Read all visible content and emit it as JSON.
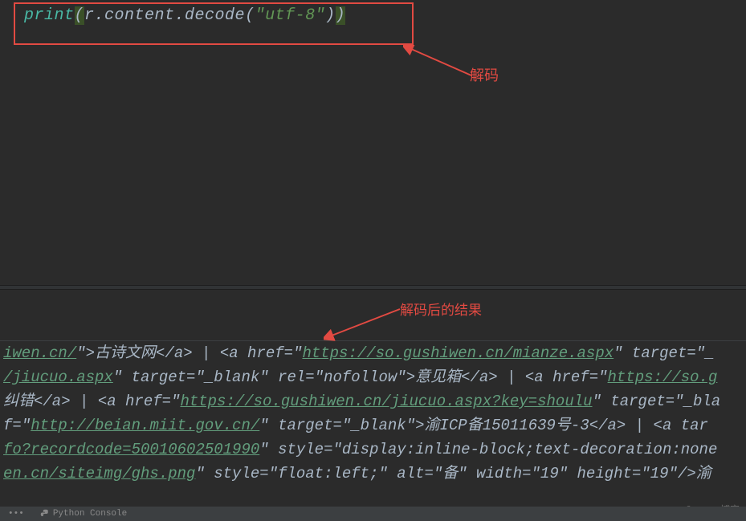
{
  "code": {
    "print": "print",
    "open_paren": "(",
    "content": "r.content.decode",
    "open_paren2": "(",
    "string": "\"utf-8\"",
    "close_paren": ")",
    "close_paren2": ")"
  },
  "annotations": {
    "decode_label": "解码",
    "result_label": "解码后的结果"
  },
  "output": {
    "line1_url": "iwen.cn/",
    "line1_text1": "\">古诗文网</a> | <a href=\"",
    "line1_url2": "https://so.gushiwen.cn/mianze.aspx",
    "line1_text2": "\" target=\"_",
    "line2_url": "/jiucuo.aspx",
    "line2_text1": "\" target=\"_blank\" rel=\"nofollow\">意见箱</a> | <a href=\"",
    "line2_url2": "https://so.g",
    "line3_text1": "纠错</a> | <a href=\"",
    "line3_url": "https://so.gushiwen.cn/jiucuo.aspx?key=shoulu",
    "line3_text2": "\" target=\"_bla",
    "line4_text1": "f=\"",
    "line4_url": "http://beian.miit.gov.cn/",
    "line4_text2": "\" target=\"_blank\">渝ICP备15011639号-3</a> | <a tar",
    "line5_url": "fo?recordcode=50010602501990",
    "line5_text": "\" style=\"display:inline-block;text-decoration:none",
    "line6_url": "en.cn/siteimg/ghs.png",
    "line6_text": "\" style=\"float:left;\" alt=\"备\" width=\"19\" height=\"19\"/>渝"
  },
  "watermark": "@51CTO博客",
  "bottom_bar": {
    "python_console": "Python Console"
  }
}
